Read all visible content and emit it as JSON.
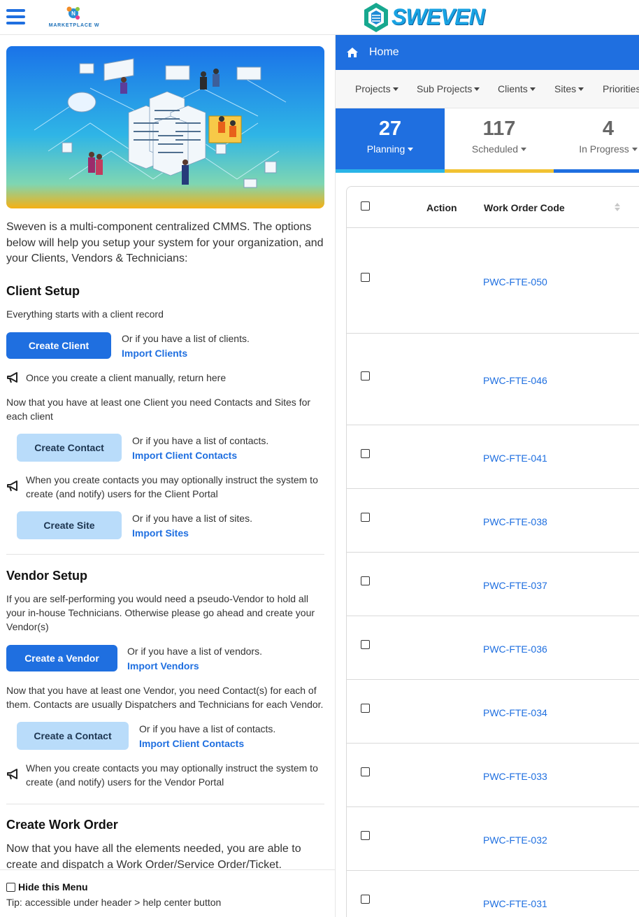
{
  "header": {
    "menu_icon": "hamburger-icon",
    "marketplace_label": "MARKETPLACE W",
    "brand_name": "SWEVEN"
  },
  "left_panel": {
    "intro": "Sweven is a multi-component centralized CMMS. The options below will help you setup your system for your organization, and your Clients, Vendors & Technicians:",
    "client_setup": {
      "title": "Client Setup",
      "subtitle": "Everything starts with a client record",
      "create_client_label": "Create Client",
      "client_alt_text": "Or if you have a list of clients.",
      "import_clients_label": "Import Clients",
      "note_return": "Once you create a client manually, return here",
      "contacts_sites_text": "Now that you have at least one Client you need Contacts and Sites for each client",
      "create_contact_label": "Create Contact",
      "contact_alt_text": "Or if you have a list of contacts.",
      "import_client_contacts_label": "Import Client Contacts",
      "note_client_portal": "When you create contacts you may optionally instruct the system to create (and notify) users for the Client Portal",
      "create_site_label": "Create Site",
      "site_alt_text": "Or if you have a list of sites.",
      "import_sites_label": "Import Sites"
    },
    "vendor_setup": {
      "title": "Vendor Setup",
      "subtitle": "If you are self-performing you would need a pseudo-Vendor to hold all your in-house Technicians. Otherwise please go ahead and create your Vendor(s)",
      "create_vendor_label": "Create a Vendor",
      "vendor_alt_text": "Or if you have a list of vendors.",
      "import_vendors_label": "Import Vendors",
      "vendor_contacts_text": "Now that you have at least one Vendor, you need Contact(s) for each of them. Contacts are usually Dispatchers and Technicians for each Vendor.",
      "create_contact_label": "Create a Contact",
      "contact_alt_text": "Or if you have a list of contacts.",
      "import_contacts_label": "Import Client Contacts",
      "note_vendor_portal": "When you create contacts you may optionally instruct the system to create (and notify) users for the Vendor Portal"
    },
    "work_order": {
      "title": "Create Work Order",
      "text": "Now that you have all the elements needed, you are able to create and dispatch a Work Order/Service Order/Ticket."
    },
    "footer": {
      "hide_menu_label": "Hide this Menu",
      "tip": "Tip: accessible under header > help center button"
    }
  },
  "right_panel": {
    "home_label": "Home",
    "filters": [
      "Projects",
      "Sub Projects",
      "Clients",
      "Sites",
      "Priorities"
    ],
    "stats": [
      {
        "count": "27",
        "label": "Planning"
      },
      {
        "count": "117",
        "label": "Scheduled"
      },
      {
        "count": "4",
        "label": "In Progress"
      }
    ],
    "table": {
      "col_action": "Action",
      "col_code": "Work Order Code",
      "rows": [
        "PWC-FTE-050",
        "PWC-FTE-046",
        "PWC-FTE-041",
        "PWC-FTE-038",
        "PWC-FTE-037",
        "PWC-FTE-036",
        "PWC-FTE-034",
        "PWC-FTE-033",
        "PWC-FTE-032",
        "PWC-FTE-031"
      ]
    }
  },
  "colors": {
    "primary": "#1f6fe0",
    "light_button": "#b9dcfa",
    "scheduled_accent": "#f1c232",
    "planning_accent": "#2ab4e8"
  }
}
